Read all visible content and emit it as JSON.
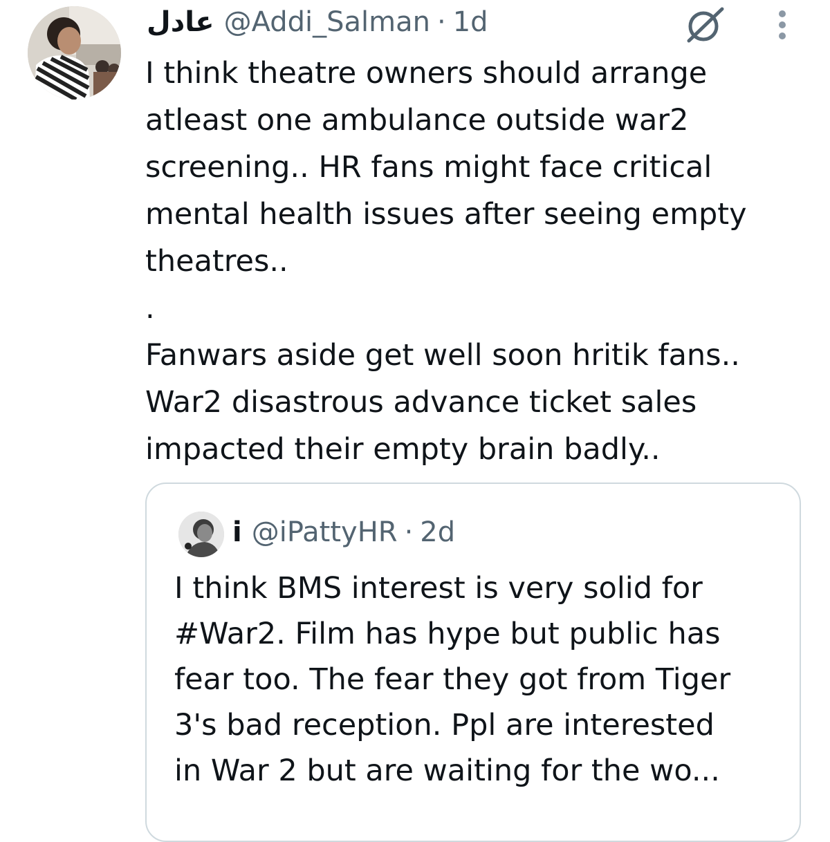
{
  "tweet": {
    "display_name": "عادل",
    "handle": "@Addi_Salman",
    "separator": "·",
    "time": "1d",
    "avatar_icon": "user-avatar-photo",
    "grok_icon": "grok-icon",
    "more_icon": "more-options-icon",
    "body_lines": [
      "I think theatre owners should arrange",
      "atleast one ambulance outside war2",
      "screening.. HR fans might face critical",
      "mental health issues after seeing empty",
      "theatres..",
      ".",
      "Fanwars aside get well soon hritik fans..",
      "War2 disastrous advance ticket sales",
      "impacted their empty brain badly.."
    ]
  },
  "quoted_tweet": {
    "display_name": "i",
    "handle": "@iPattyHR",
    "separator": "·",
    "time": "2d",
    "avatar_icon": "user-avatar-photo",
    "body_lines": [
      "I think BMS interest is very solid for",
      "#War2. Film has hype but public has",
      "fear too. The fear they got from Tiger",
      "3's bad reception. Ppl are interested",
      "in War 2 but are waiting for the wo..."
    ]
  },
  "colors": {
    "text_primary": "#0f1419",
    "text_secondary": "#536471",
    "border": "#cfd9de",
    "background": "#ffffff"
  }
}
